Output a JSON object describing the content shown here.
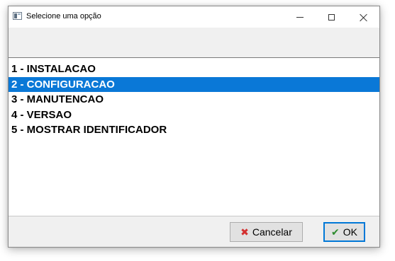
{
  "window": {
    "title": "Selecione uma opção"
  },
  "options": [
    {
      "label": "1 - INSTALACAO",
      "selected": false
    },
    {
      "label": "2 - CONFIGURACAO",
      "selected": true
    },
    {
      "label": "3 - MANUTENCAO",
      "selected": false
    },
    {
      "label": "4 - VERSAO",
      "selected": false
    },
    {
      "label": "5 - MOSTRAR IDENTIFICADOR",
      "selected": false
    }
  ],
  "buttons": {
    "cancel_label": "Cancelar",
    "cancel_icon": "x-icon",
    "ok_label": "OK",
    "ok_icon": "check-icon"
  },
  "colors": {
    "selection": "#0a78d7",
    "cancel_icon": "#d32f2f",
    "ok_icon": "#2e8b2e",
    "ok_border": "#0078d7"
  }
}
